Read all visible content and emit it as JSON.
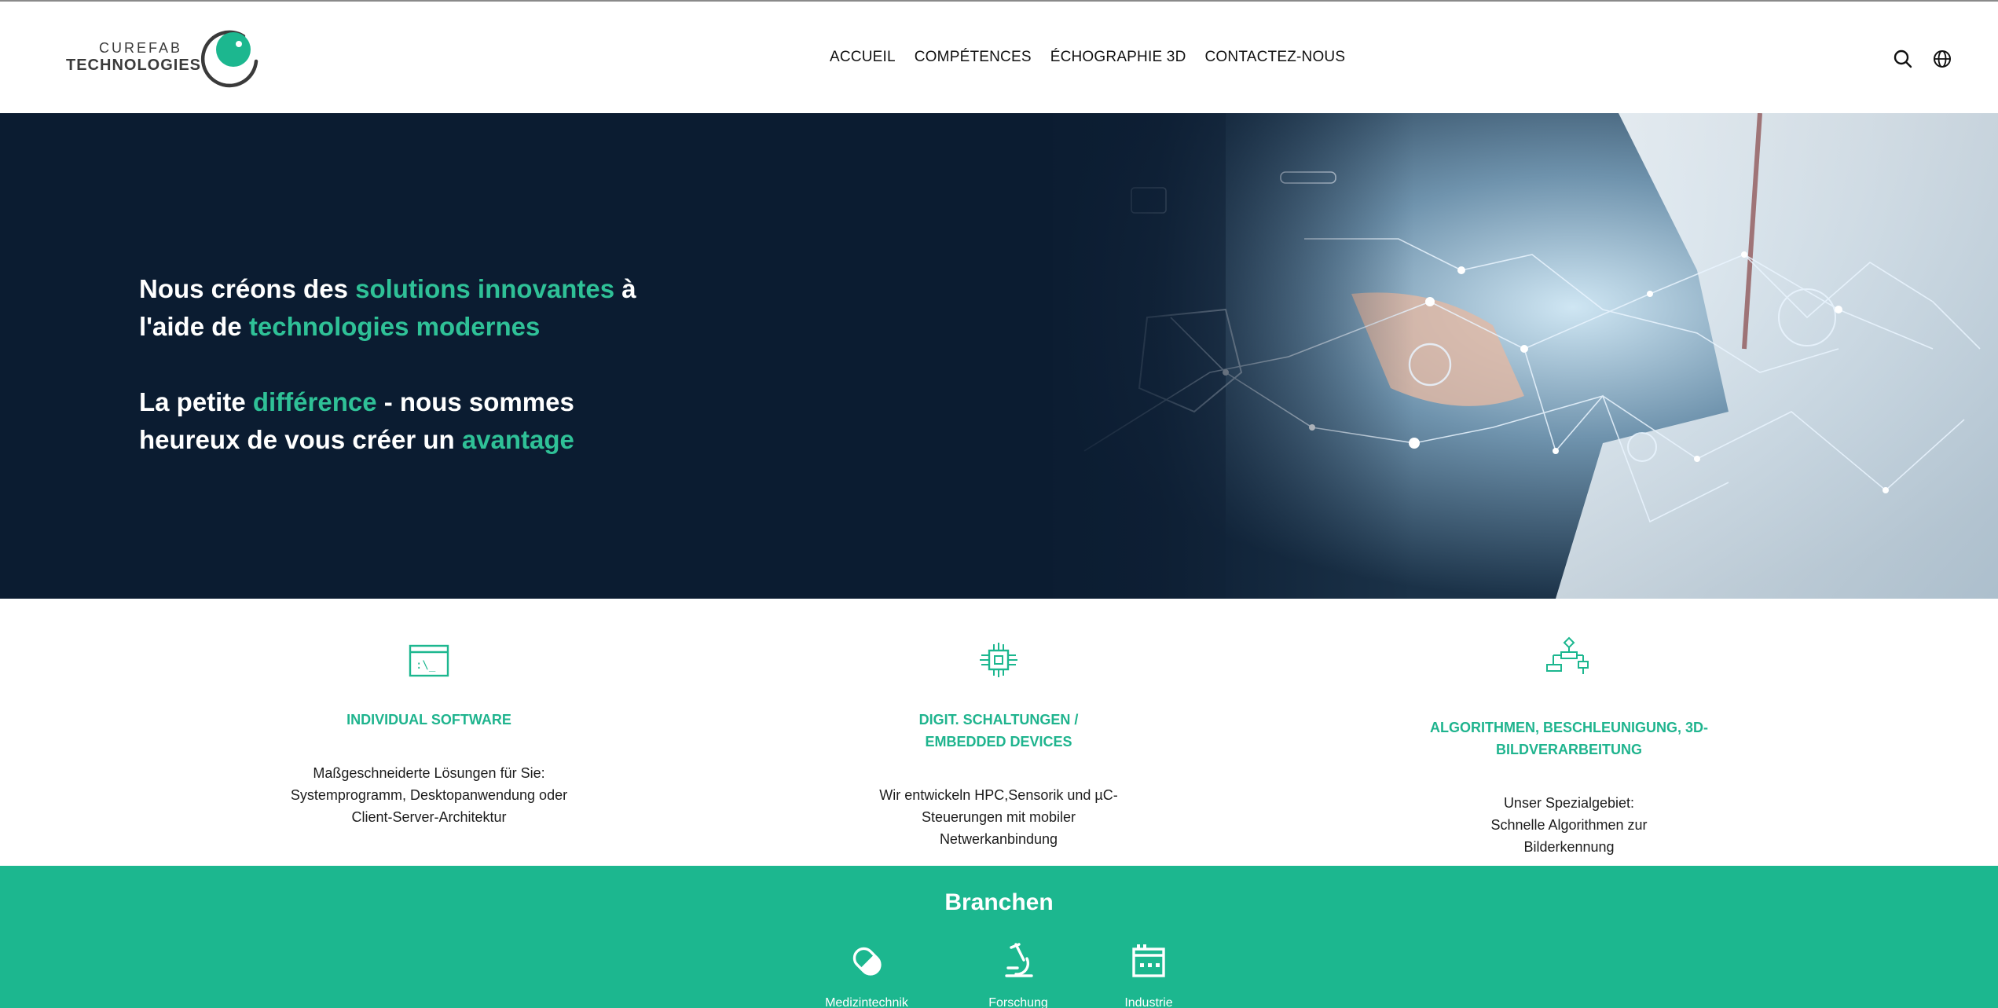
{
  "logo": {
    "line1": "CUREFAB",
    "line2": "TECHNOLOGIES"
  },
  "nav": [
    "ACCUEIL",
    "COMPÉTENCES",
    "ÉCHOGRAPHIE 3D",
    "CONTACTEZ-NOUS"
  ],
  "header_icons": [
    "search-icon",
    "globe-icon"
  ],
  "hero": {
    "line1_a": "Nous créons des ",
    "line1_hl": "solutions innovantes",
    "line1_b": " à",
    "line2_a": "l'aide de ",
    "line2_hl": "technologies modernes",
    "line3_a": "La petite ",
    "line3_hl": "différence",
    "line3_b": " - nous sommes",
    "line4_a": "heureux de vous créer un ",
    "line4_hl": "avantage"
  },
  "features": [
    {
      "title": "INDIVIDUAL SOFTWARE",
      "text": "Maßgeschneiderte Lösungen für Sie: Systemprogramm, Desktopanwendung oder Client-Server-Architektur",
      "icon": "terminal-window-icon"
    },
    {
      "title": "DIGIT. SCHALTUNGEN / EMBEDDED DEVICES",
      "text": "Wir entwickeln HPC,Sensorik und µC-Steuerungen mit mobiler Netwerkanbindung",
      "icon": "chip-icon"
    },
    {
      "title": "ALGORITHMEN, BESCHLEUNIGUNG, 3D-BILDVERARBEITUNG",
      "text": "Unser Spezialgebiet: Schnelle Algorithmen zur Bilderkennung",
      "icon": "flowchart-icon"
    }
  ],
  "branchen": {
    "title": "Branchen",
    "items": [
      {
        "label": "Medizintechnik",
        "icon": "pill-icon"
      },
      {
        "label": "Forschung",
        "icon": "microscope-icon"
      },
      {
        "label": "Industrie",
        "icon": "factory-icon"
      }
    ]
  },
  "colors": {
    "accent": "#1cb78f",
    "hero_bg": "#0b1c31"
  }
}
